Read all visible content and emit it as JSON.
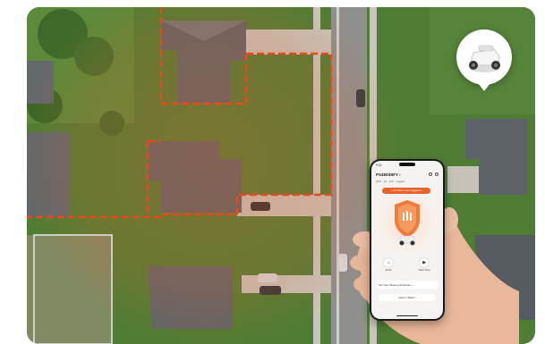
{
  "phone": {
    "status_time": "9:41",
    "device_name": "PS480iDIFY ›",
    "device_stats": "62% · 3d · 12h · Logged",
    "alert": "• Not Well-Lawn triggered",
    "actions": [
      {
        "label": "Dock",
        "icon": "home-icon"
      },
      {
        "label": "Start Now",
        "icon": "play-icon"
      }
    ],
    "schedule_label": "Set Your Mowing Schedule ›",
    "view_map_label": "View in Maps ›"
  },
  "colors": {
    "zone_border": "#e84a1e",
    "coverage_glow": "#e8602a",
    "lawn": "#4f7d34",
    "road": "#8f8f8d"
  }
}
